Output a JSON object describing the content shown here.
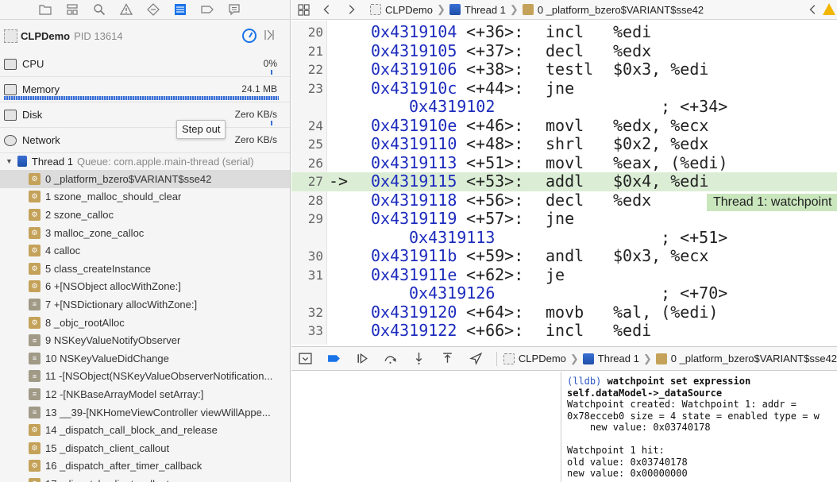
{
  "navigator": {
    "process": {
      "name": "CLPDemo",
      "pid": "PID 13614"
    },
    "gauges": [
      {
        "label": "CPU",
        "value": "0%"
      },
      {
        "label": "Memory",
        "value": "24.1 MB"
      },
      {
        "label": "Disk",
        "value": "Zero KB/s"
      },
      {
        "label": "Network",
        "value": "Zero KB/s"
      }
    ],
    "tooltip": "Step out",
    "thread": {
      "name": "Thread 1",
      "queue": "Queue: com.apple.main-thread (serial)"
    },
    "frames": [
      {
        "label": "0 _platform_bzero$VARIANT$sse42",
        "icon": "gear-icon",
        "selected": true
      },
      {
        "label": "1 szone_malloc_should_clear",
        "icon": "gear-icon"
      },
      {
        "label": "2 szone_calloc",
        "icon": "gear-icon"
      },
      {
        "label": "3 malloc_zone_calloc",
        "icon": "gear-icon"
      },
      {
        "label": "4 calloc",
        "icon": "gear-icon"
      },
      {
        "label": "5 class_createInstance",
        "icon": "gear-icon"
      },
      {
        "label": "6 +[NSObject allocWithZone:]",
        "icon": "gear-icon"
      },
      {
        "label": "7 +[NSDictionary allocWithZone:]",
        "icon": "lines-icon"
      },
      {
        "label": "8 _objc_rootAlloc",
        "icon": "gear-icon"
      },
      {
        "label": "9 NSKeyValueNotifyObserver",
        "icon": "lines-icon"
      },
      {
        "label": "10 NSKeyValueDidChange",
        "icon": "lines-icon"
      },
      {
        "label": "11 -[NSObject(NSKeyValueObserverNotification...",
        "icon": "lines-icon"
      },
      {
        "label": "12 -[NKBaseArrayModel setArray:]",
        "icon": "lines-icon"
      },
      {
        "label": "13 __39-[NKHomeViewController viewWillAppe...",
        "icon": "lines-icon"
      },
      {
        "label": "14 _dispatch_call_block_and_release",
        "icon": "gear-icon"
      },
      {
        "label": "15 _dispatch_client_callout",
        "icon": "gear-icon"
      },
      {
        "label": "16 _dispatch_after_timer_callback",
        "icon": "gear-icon"
      },
      {
        "label": "17 _dispatch_client_callout",
        "icon": "gear-icon"
      }
    ]
  },
  "breadcrumb": {
    "project": "CLPDemo",
    "thread": "Thread 1",
    "frame": "0 _platform_bzero$VARIANT$sse42"
  },
  "disassembly": {
    "lines": [
      {
        "ln": "20",
        "addr": "0x4319104",
        "off": "<+36>:",
        "mnem": "incl",
        "ops": "%edi"
      },
      {
        "ln": "21",
        "addr": "0x4319105",
        "off": "<+37>:",
        "mnem": "decl",
        "ops": "%edx"
      },
      {
        "ln": "22",
        "addr": "0x4319106",
        "off": "<+38>:",
        "mnem": "testl",
        "ops": "$0x3, %edi"
      },
      {
        "ln": "23",
        "addr": "0x431910c",
        "off": "<+44>:",
        "mnem": "jne",
        "ops": ""
      },
      {
        "ln": "",
        "cont_addr": "0x4319102",
        "cont_tail": "; <+34>"
      },
      {
        "ln": "24",
        "addr": "0x431910e",
        "off": "<+46>:",
        "mnem": "movl",
        "ops": "%edx, %ecx"
      },
      {
        "ln": "25",
        "addr": "0x4319110",
        "off": "<+48>:",
        "mnem": "shrl",
        "ops": "$0x2, %edx"
      },
      {
        "ln": "26",
        "addr": "0x4319113",
        "off": "<+51>:",
        "mnem": "movl",
        "ops": "%eax, (%edi)"
      },
      {
        "ln": "27",
        "addr": "0x4319115",
        "off": "<+53>:",
        "mnem": "addl",
        "ops": "$0x4, %edi",
        "pc": true,
        "arrow": "->"
      },
      {
        "ln": "28",
        "addr": "0x4319118",
        "off": "<+56>:",
        "mnem": "decl",
        "ops": "%edx"
      },
      {
        "ln": "29",
        "addr": "0x4319119",
        "off": "<+57>:",
        "mnem": "jne",
        "ops": ""
      },
      {
        "ln": "",
        "cont_addr": "0x4319113",
        "cont_tail": "; <+51>"
      },
      {
        "ln": "30",
        "addr": "0x431911b",
        "off": "<+59>:",
        "mnem": "andl",
        "ops": "$0x3, %ecx"
      },
      {
        "ln": "31",
        "addr": "0x431911e",
        "off": "<+62>:",
        "mnem": "je",
        "ops": ""
      },
      {
        "ln": "",
        "cont_addr": "0x4319126",
        "cont_tail": "; <+70>"
      },
      {
        "ln": "32",
        "addr": "0x4319120",
        "off": "<+64>:",
        "mnem": "movb",
        "ops": "%al, (%edi)"
      },
      {
        "ln": "33",
        "addr": "0x4319122",
        "off": "<+66>:",
        "mnem": "incl",
        "ops": "%edi"
      }
    ],
    "watch_badge": "Thread 1: watchpoint"
  },
  "console": {
    "prompt": "(lldb)",
    "command_line1": " watchpoint set expression",
    "command_line2": "self.dataModel->_dataSource",
    "output": "Watchpoint created: Watchpoint 1: addr =\n0x78ecceb0 size = 4 state = enabled type = w\n    new value: 0x03740178\n\nWatchpoint 1 hit:\nold value: 0x03740178\nnew value: 0x00000000"
  }
}
